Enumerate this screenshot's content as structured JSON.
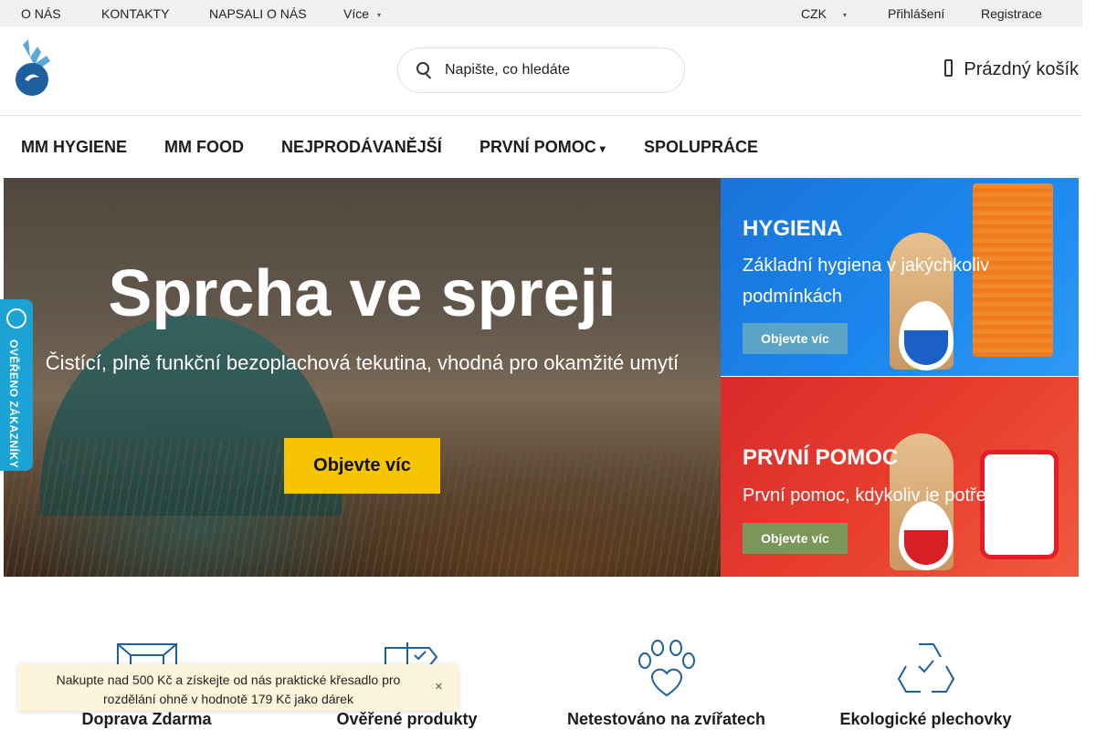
{
  "topbar": {
    "links": [
      "O NÁS",
      "KONTAKTY",
      "NAPSALI O NÁS"
    ],
    "more_label": "Více",
    "currency": "CZK",
    "login": "Přihlášení",
    "register": "Registrace"
  },
  "header": {
    "search_placeholder": "Napište, co hledáte",
    "cart_label": "Prázdný košík"
  },
  "nav": {
    "items": [
      "MM HYGIENE",
      "MM FOOD",
      "NEJPRODÁVANĚJŠÍ",
      "PRVNÍ POMOC",
      "SPOLUPRÁCE"
    ]
  },
  "hero": {
    "title": "Sprcha ve spreji",
    "subtitle": "Čistící, plně funkční bezoplachová tekutina, vhodná pro okamžité umytí",
    "button": "Objevte víc"
  },
  "promos": [
    {
      "title": "HYGIENA",
      "text": "Základní hygiena v jakýchkoliv podmínkách",
      "button": "Objevte víc"
    },
    {
      "title": "PRVNÍ POMOC",
      "text": "První pomoc, kdykoliv je potřeba",
      "button": "Objevte víc"
    }
  ],
  "badge": {
    "text": "OVĚŘENO ZÁKAZNÍKY"
  },
  "features": [
    {
      "label": "Doprava Zdarma",
      "icon": "box-icon"
    },
    {
      "label": "Ověřené produkty",
      "icon": "signpost-icon"
    },
    {
      "label": "Netestováno na zvířatech",
      "icon": "paw-heart-icon"
    },
    {
      "label": "Ekologické plechovky",
      "icon": "recycle-icon"
    }
  ],
  "toast": {
    "message": "Nakupte nad 500 Kč a získejte od nás praktické křesadlo pro rozdělání ohně v hodnotě 179 Kč jako dárek"
  },
  "colors": {
    "accent_yellow": "#f6c400",
    "hygiene_blue": "#1b86ee",
    "first_aid_red": "#e8402f",
    "badge_blue": "#1ba3d6",
    "icon_blue": "#1f5f9e"
  }
}
